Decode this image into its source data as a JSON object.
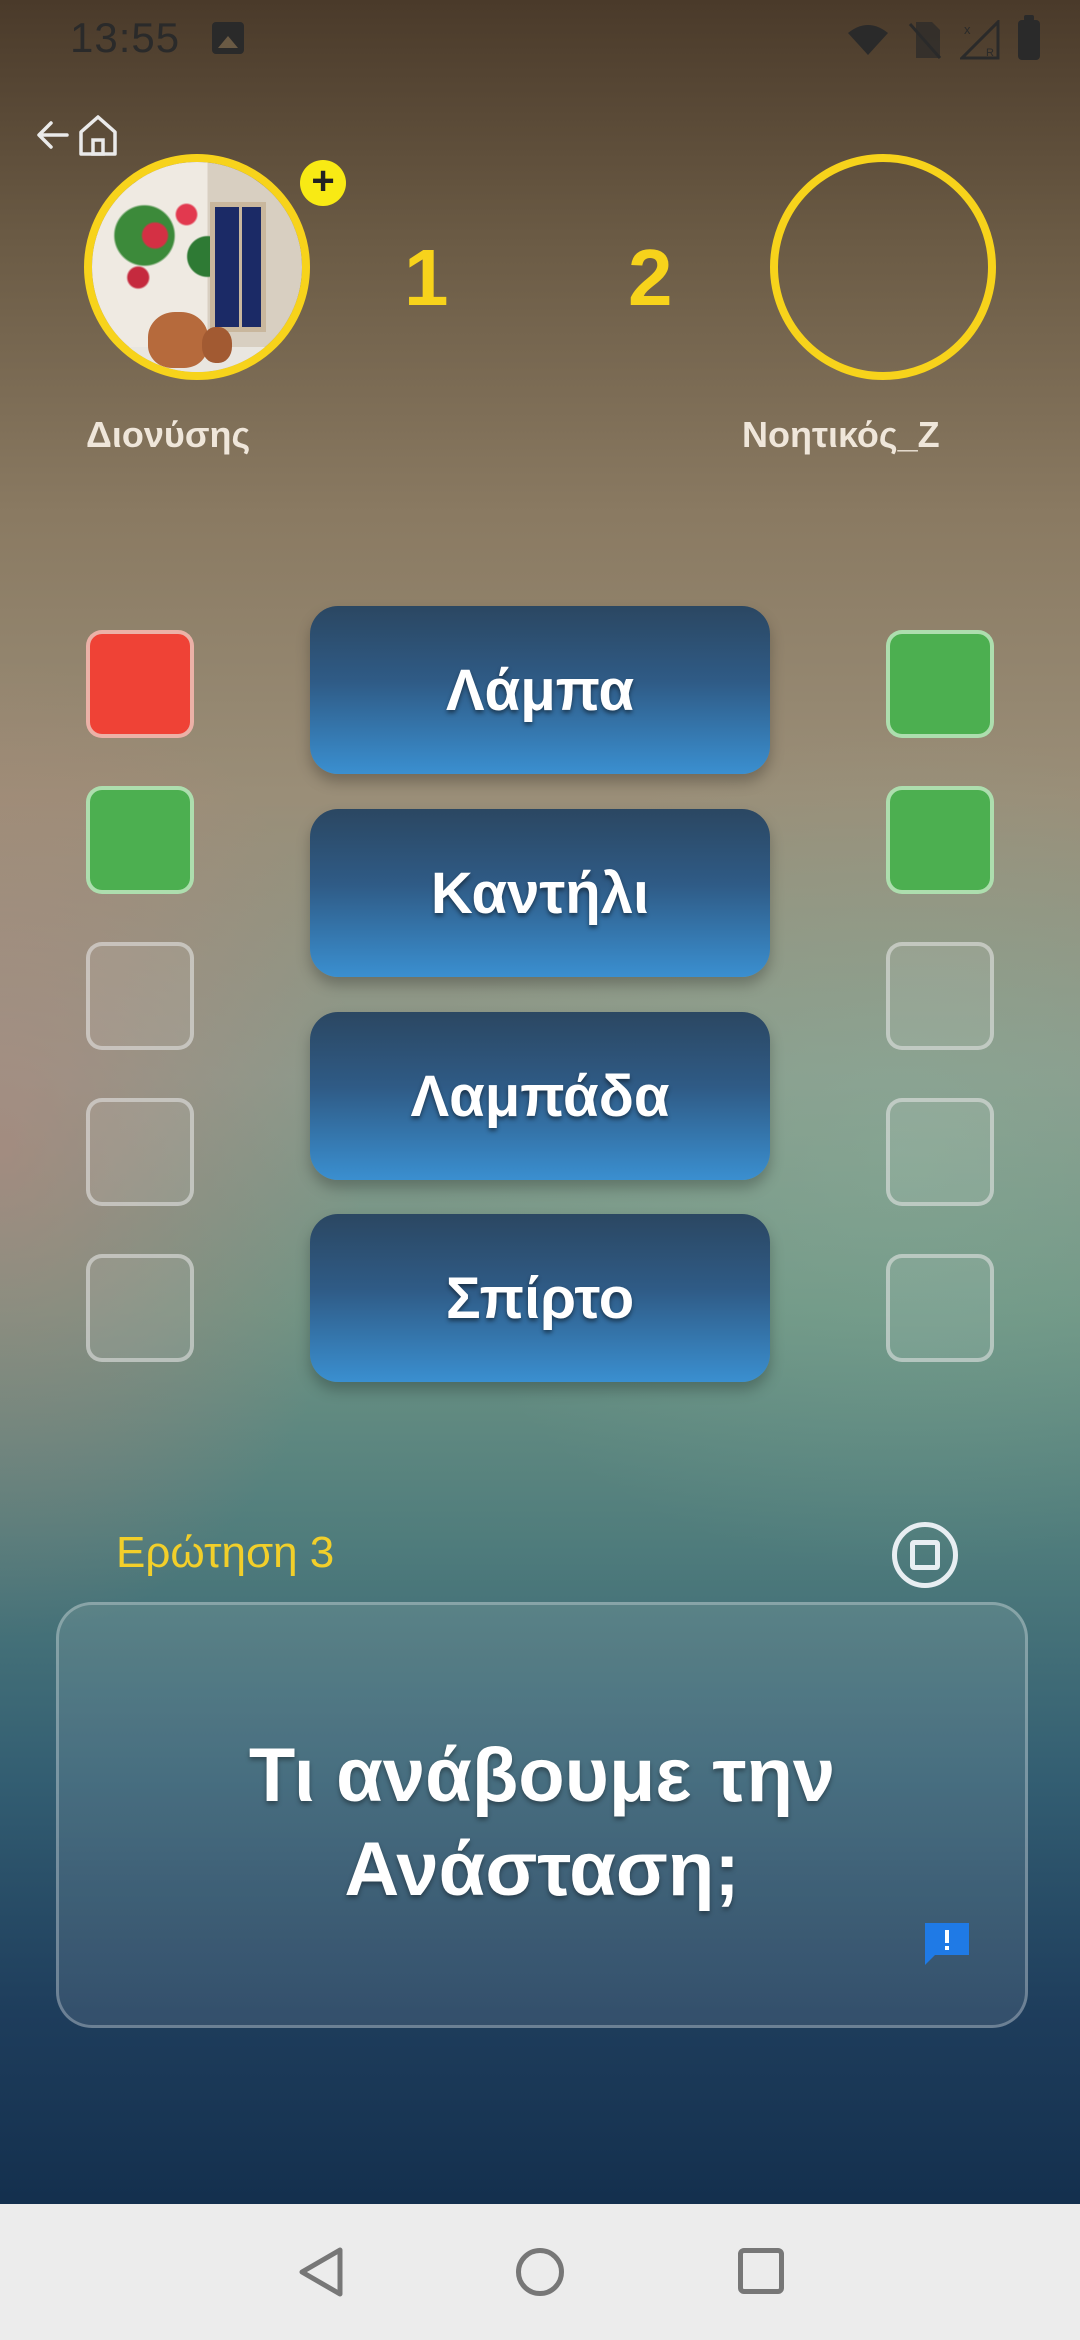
{
  "status_bar": {
    "time": "13:55"
  },
  "players": {
    "left": {
      "name": "Διονύσης",
      "score": "1",
      "badge": "+"
    },
    "right": {
      "name": "Νοητικός_Ζ",
      "score": "2"
    }
  },
  "progress": {
    "left": [
      "red",
      "green",
      "empty",
      "empty",
      "empty"
    ],
    "right": [
      "green",
      "green",
      "empty",
      "empty",
      "empty"
    ]
  },
  "answers": [
    "Λάμπα",
    "Καντήλι",
    "Λαμπάδα",
    "Σπίρτο"
  ],
  "question": {
    "label": "Ερώτηση 3",
    "line1": "Τι ανάβουμε την",
    "line2": "Ανάσταση;"
  },
  "icons": {
    "back": "back-arrow-icon",
    "home": "home-icon",
    "stop": "stop-icon",
    "report": "report-icon"
  },
  "colors": {
    "accent_yellow": "#f7d31b",
    "wrong": "#ef4236",
    "correct": "#4caf50",
    "answer_button": "#3a8fd0"
  }
}
